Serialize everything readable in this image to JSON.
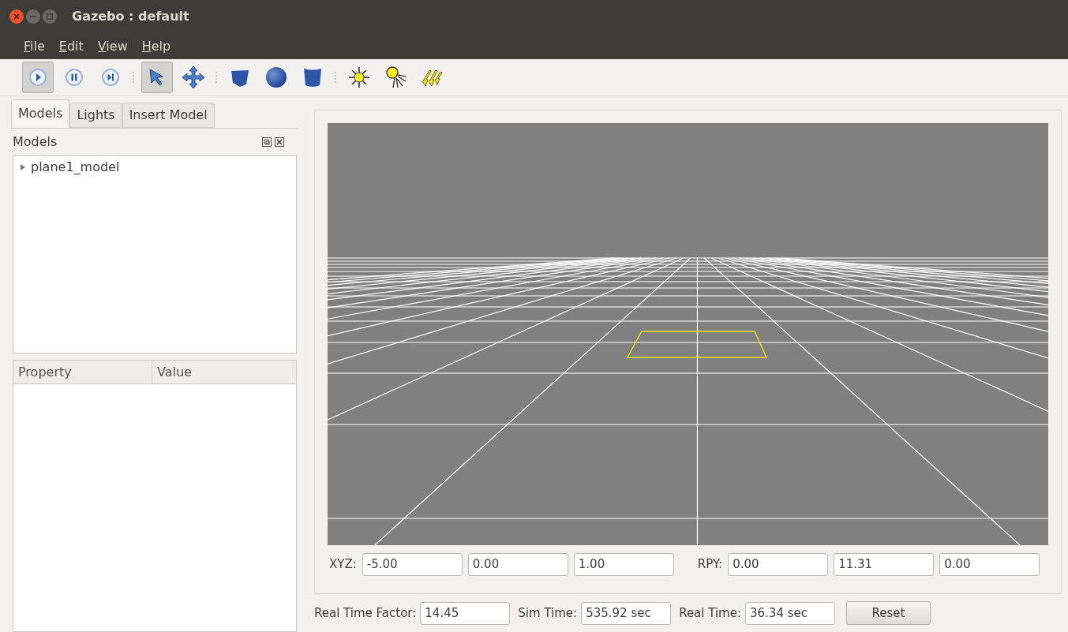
{
  "window": {
    "title": "Gazebo : default"
  },
  "menu": [
    "File",
    "Edit",
    "View",
    "Help"
  ],
  "toolbar": [
    {
      "kind": "play",
      "selected": true
    },
    {
      "kind": "pause",
      "selected": false
    },
    {
      "kind": "step",
      "selected": false
    },
    {
      "kind": "separator"
    },
    {
      "kind": "select",
      "selected": true
    },
    {
      "kind": "translate",
      "selected": false
    },
    {
      "kind": "separator"
    },
    {
      "kind": "box",
      "selected": false
    },
    {
      "kind": "sphere",
      "selected": false
    },
    {
      "kind": "cylinder",
      "selected": false
    },
    {
      "kind": "separator"
    },
    {
      "kind": "point_light",
      "selected": false
    },
    {
      "kind": "spot_light",
      "selected": false
    },
    {
      "kind": "directional_light",
      "selected": false
    }
  ],
  "tabs": [
    {
      "label": "Models",
      "selected": true
    },
    {
      "label": "Lights",
      "selected": false
    },
    {
      "label": "Insert Model",
      "selected": false
    }
  ],
  "models_panel": {
    "title": "Models",
    "tree": [
      {
        "label": "plane1_model",
        "expanded": false
      }
    ]
  },
  "property_table": {
    "columns": [
      "Property",
      "Value"
    ]
  },
  "pose": {
    "xyz_label": "XYZ:",
    "xyz": [
      "-5.00",
      "0.00",
      "1.00"
    ],
    "rpy_label": "RPY:",
    "rpy": [
      "0.00",
      "11.31",
      "0.00"
    ]
  },
  "status": [
    {
      "label": "Real Time Factor:",
      "value": "14.45"
    },
    {
      "label": "Sim Time:",
      "value": "535.92 sec"
    },
    {
      "label": "Real Time:",
      "value": "36.34 sec"
    }
  ],
  "reset_button": "Reset"
}
